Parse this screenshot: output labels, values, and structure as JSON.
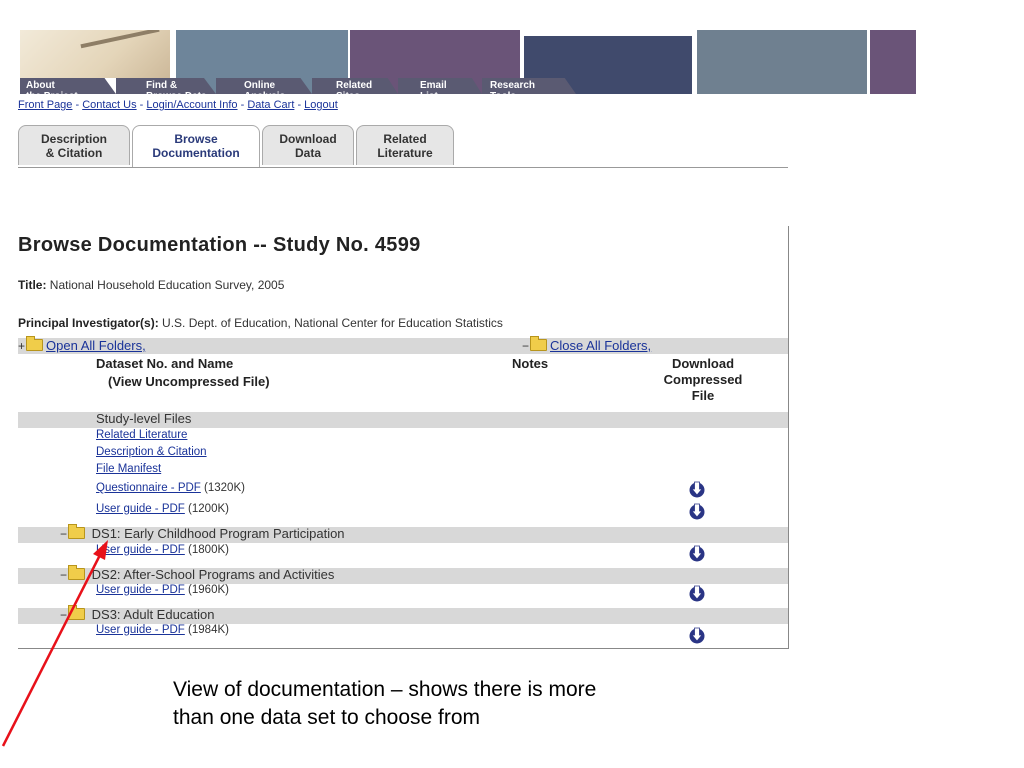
{
  "banner": {
    "nav": [
      {
        "label": "About\nthe Project"
      },
      {
        "label": "Find &\nBrowse Data"
      },
      {
        "label": "Online\nAnalysis"
      },
      {
        "label": "Related\nSites"
      },
      {
        "label": "Email\nList"
      },
      {
        "label": "Research\nTools"
      }
    ],
    "colors": {
      "steel": "#6e859a",
      "plum": "#6a5478",
      "navy": "#404a6c",
      "slate": "#6f8090"
    }
  },
  "links": [
    {
      "label": "Front Page"
    },
    {
      "label": "Contact Us"
    },
    {
      "label": "Login/Account Info"
    },
    {
      "label": "Data Cart"
    },
    {
      "label": "Logout"
    }
  ],
  "link_separator": " - ",
  "tabs": [
    {
      "label": "Description\n& Citation"
    },
    {
      "label": "Browse\nDocumentation"
    },
    {
      "label": "Download\nData"
    },
    {
      "label": "Related\nLiterature"
    }
  ],
  "page": {
    "heading": "Browse Documentation -- Study No. 4599",
    "title_label": "Title:",
    "title_value": "National Household Education Survey, 2005",
    "pi_label": "Principal Investigator(s):",
    "pi_value": "U.S. Dept. of Education, National Center for Education Statistics"
  },
  "folders": {
    "open_all": "Open All Folders,",
    "close_all": "Close All Folders,"
  },
  "columns": {
    "dataset": "Dataset No. and Name",
    "dataset_sub": "(View Uncompressed File)",
    "notes": "Notes",
    "download": "Download\nCompressed\nFile"
  },
  "study_level": {
    "label": "Study-level Files",
    "files": [
      {
        "link": "Related Literature",
        "size": ""
      },
      {
        "link": "Description & Citation",
        "size": ""
      },
      {
        "link": "File Manifest",
        "size": ""
      },
      {
        "link": "Questionnaire - PDF",
        "size": "(1320K)"
      },
      {
        "link": "User guide - PDF",
        "size": "(1200K)"
      }
    ]
  },
  "datasets": [
    {
      "name": "DS1: Early Childhood Program Participation",
      "file": "User guide - PDF",
      "size": "(1800K)"
    },
    {
      "name": "DS2: After-School Programs and Activities",
      "file": "User guide - PDF",
      "size": "(1960K)"
    },
    {
      "name": "DS3: Adult Education",
      "file": "User guide - PDF",
      "size": "(1984K)"
    }
  ],
  "caption": {
    "line1": "View of documentation – shows there is more",
    "line2": "than one data set to choose from"
  },
  "icons": {
    "download": "download-arrow-icon",
    "folder": "folder-icon"
  },
  "accent": {
    "link": "#1a3399",
    "arrow": "#e8111a",
    "icon": "#2a3585"
  }
}
